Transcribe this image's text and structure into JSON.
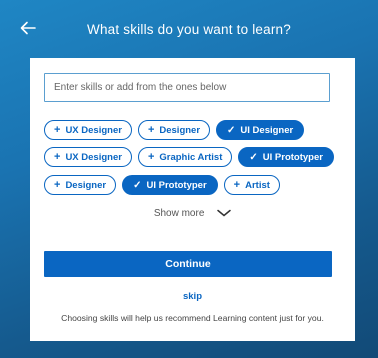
{
  "header": {
    "title": "What skills do you want to learn?",
    "back_icon": "back-arrow-icon"
  },
  "search": {
    "placeholder": "Enter skills or add from the ones below",
    "value": ""
  },
  "chip_rows": [
    [
      {
        "label": "UX Designer",
        "selected": false
      },
      {
        "label": "Designer",
        "selected": false
      },
      {
        "label": "UI Designer",
        "selected": true
      }
    ],
    [
      {
        "label": "UX Designer",
        "selected": false
      },
      {
        "label": "Graphic Artist",
        "selected": false
      },
      {
        "label": "UI Prototyper",
        "selected": true
      }
    ],
    [
      {
        "label": "Designer",
        "selected": false
      },
      {
        "label": "UI Prototyper",
        "selected": true
      },
      {
        "label": "Artist",
        "selected": false
      }
    ]
  ],
  "glyphs": {
    "unselected": "+",
    "selected": "✓"
  },
  "show_more": {
    "label": "Show more",
    "icon": "chevron-down-icon"
  },
  "continue_label": "Continue",
  "skip_label": "skip",
  "footer_text": "Choosing skills will help us recommend Learning content just for you.",
  "colors": {
    "accent": "#0a66c2",
    "background": "#1a73b1",
    "card": "#ffffff"
  }
}
